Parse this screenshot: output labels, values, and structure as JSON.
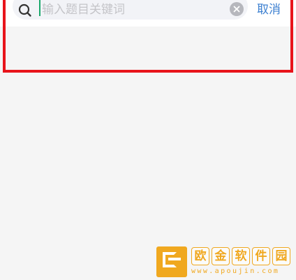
{
  "search": {
    "value": "",
    "placeholder": "输入题目关键词",
    "cancel_label": "取消"
  },
  "icons": {
    "search": "search-icon",
    "clear": "clear-icon"
  },
  "watermark": {
    "chars": [
      "欧",
      "金",
      "软",
      "件",
      "园"
    ],
    "url": "www.apoujin.com"
  },
  "colors": {
    "accent": "#3b7fd0",
    "highlight": "#e8141b",
    "caret": "#1aa86b",
    "watermark": "#f0a81f",
    "background": "#f5f5f5"
  }
}
